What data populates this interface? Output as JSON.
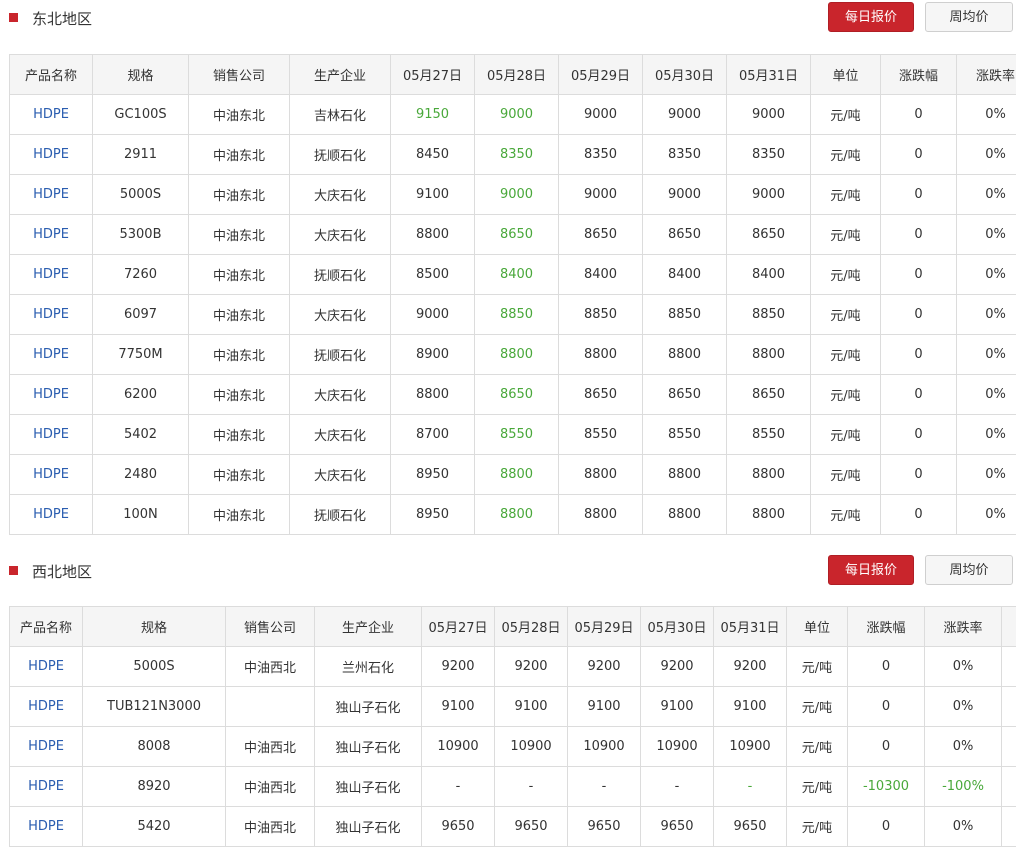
{
  "columns": [
    "产品名称",
    "规格",
    "销售公司",
    "生产企业",
    "05月27日",
    "05月28日",
    "05月29日",
    "05月30日",
    "05月31日",
    "单位",
    "涨跌幅",
    "涨跌率"
  ],
  "buttons": {
    "daily": "每日报价",
    "weekly": "周均价"
  },
  "sections": [
    {
      "title": "东北地区",
      "rows": [
        {
          "name": "HDPE",
          "spec": "GC100S",
          "seller": "中油东北",
          "producer": "吉林石化",
          "p": [
            "9150",
            "9000",
            "9000",
            "9000",
            "9000"
          ],
          "unit": "元/吨",
          "chg": "0",
          "rate": "0%",
          "green": [
            0,
            1
          ]
        },
        {
          "name": "HDPE",
          "spec": "2911",
          "seller": "中油东北",
          "producer": "抚顺石化",
          "p": [
            "8450",
            "8350",
            "8350",
            "8350",
            "8350"
          ],
          "unit": "元/吨",
          "chg": "0",
          "rate": "0%",
          "green": [
            1
          ]
        },
        {
          "name": "HDPE",
          "spec": "5000S",
          "seller": "中油东北",
          "producer": "大庆石化",
          "p": [
            "9100",
            "9000",
            "9000",
            "9000",
            "9000"
          ],
          "unit": "元/吨",
          "chg": "0",
          "rate": "0%",
          "green": [
            1
          ]
        },
        {
          "name": "HDPE",
          "spec": "5300B",
          "seller": "中油东北",
          "producer": "大庆石化",
          "p": [
            "8800",
            "8650",
            "8650",
            "8650",
            "8650"
          ],
          "unit": "元/吨",
          "chg": "0",
          "rate": "0%",
          "green": [
            1
          ]
        },
        {
          "name": "HDPE",
          "spec": "7260",
          "seller": "中油东北",
          "producer": "抚顺石化",
          "p": [
            "8500",
            "8400",
            "8400",
            "8400",
            "8400"
          ],
          "unit": "元/吨",
          "chg": "0",
          "rate": "0%",
          "green": [
            1
          ]
        },
        {
          "name": "HDPE",
          "spec": "6097",
          "seller": "中油东北",
          "producer": "大庆石化",
          "p": [
            "9000",
            "8850",
            "8850",
            "8850",
            "8850"
          ],
          "unit": "元/吨",
          "chg": "0",
          "rate": "0%",
          "green": [
            1
          ]
        },
        {
          "name": "HDPE",
          "spec": "7750M",
          "seller": "中油东北",
          "producer": "抚顺石化",
          "p": [
            "8900",
            "8800",
            "8800",
            "8800",
            "8800"
          ],
          "unit": "元/吨",
          "chg": "0",
          "rate": "0%",
          "green": [
            1
          ]
        },
        {
          "name": "HDPE",
          "spec": "6200",
          "seller": "中油东北",
          "producer": "大庆石化",
          "p": [
            "8800",
            "8650",
            "8650",
            "8650",
            "8650"
          ],
          "unit": "元/吨",
          "chg": "0",
          "rate": "0%",
          "green": [
            1
          ]
        },
        {
          "name": "HDPE",
          "spec": "5402",
          "seller": "中油东北",
          "producer": "大庆石化",
          "p": [
            "8700",
            "8550",
            "8550",
            "8550",
            "8550"
          ],
          "unit": "元/吨",
          "chg": "0",
          "rate": "0%",
          "green": [
            1
          ]
        },
        {
          "name": "HDPE",
          "spec": "2480",
          "seller": "中油东北",
          "producer": "大庆石化",
          "p": [
            "8950",
            "8800",
            "8800",
            "8800",
            "8800"
          ],
          "unit": "元/吨",
          "chg": "0",
          "rate": "0%",
          "green": [
            1
          ]
        },
        {
          "name": "HDPE",
          "spec": "100N",
          "seller": "中油东北",
          "producer": "抚顺石化",
          "p": [
            "8950",
            "8800",
            "8800",
            "8800",
            "8800"
          ],
          "unit": "元/吨",
          "chg": "0",
          "rate": "0%",
          "green": [
            1
          ]
        }
      ]
    },
    {
      "title": "西北地区",
      "rows": [
        {
          "name": "HDPE",
          "spec": "5000S",
          "seller": "中油西北",
          "producer": "兰州石化",
          "p": [
            "9200",
            "9200",
            "9200",
            "9200",
            "9200"
          ],
          "unit": "元/吨",
          "chg": "0",
          "rate": "0%",
          "green": []
        },
        {
          "name": "HDPE",
          "spec": "TUB121N3000",
          "seller": "",
          "producer": "独山子石化",
          "p": [
            "9100",
            "9100",
            "9100",
            "9100",
            "9100"
          ],
          "unit": "元/吨",
          "chg": "0",
          "rate": "0%",
          "green": []
        },
        {
          "name": "HDPE",
          "spec": "8008",
          "seller": "中油西北",
          "producer": "独山子石化",
          "p": [
            "10900",
            "10900",
            "10900",
            "10900",
            "10900"
          ],
          "unit": "元/吨",
          "chg": "0",
          "rate": "0%",
          "green": []
        },
        {
          "name": "HDPE",
          "spec": "8920",
          "seller": "中油西北",
          "producer": "独山子石化",
          "p": [
            "-",
            "-",
            "-",
            "-",
            "-"
          ],
          "unit": "元/吨",
          "chg": "-10300",
          "rate": "-100%",
          "green": [
            4
          ],
          "chgGreen": true
        },
        {
          "name": "HDPE",
          "spec": "5420",
          "seller": "中油西北",
          "producer": "独山子石化",
          "p": [
            "9650",
            "9650",
            "9650",
            "9650",
            "9650"
          ],
          "unit": "元/吨",
          "chg": "0",
          "rate": "0%",
          "green": []
        }
      ]
    }
  ],
  "colors": {
    "accent": "#c9252c",
    "link": "#2a5db0",
    "down": "#49a83a"
  }
}
